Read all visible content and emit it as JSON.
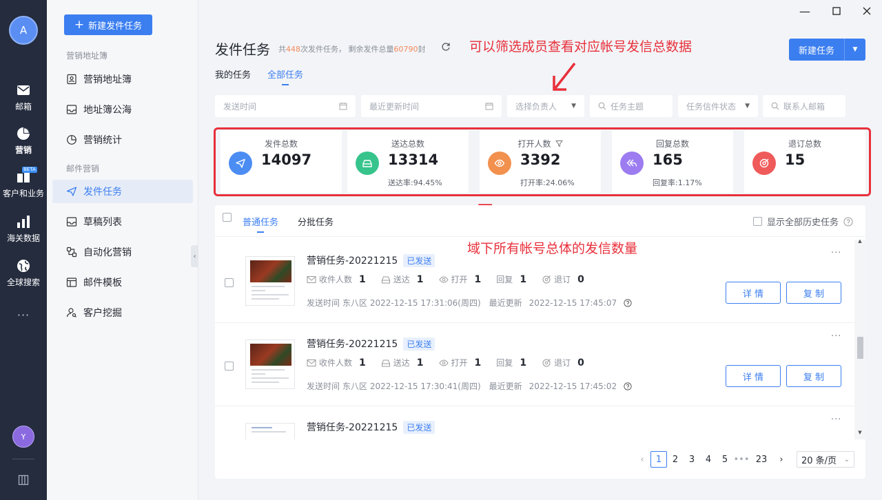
{
  "rail": {
    "user_initial": "A",
    "items": [
      {
        "label": "邮箱",
        "icon": "mail-icon"
      },
      {
        "label": "营销",
        "icon": "pie-chart-icon"
      },
      {
        "label": "客户和业务",
        "icon": "customer-business-icon",
        "badge": "BETA"
      },
      {
        "label": "海关数据",
        "icon": "bar-chart-icon"
      },
      {
        "label": "全球搜索",
        "icon": "globe-icon"
      }
    ],
    "more": "···",
    "bottom_avatar": "Y"
  },
  "sidebar": {
    "new_button": "新建发件任务",
    "section1": "营销地址簿",
    "section2": "邮件营销",
    "items": [
      {
        "label": "营销地址簿",
        "icon": "contact-book-icon"
      },
      {
        "label": "地址簿公海",
        "icon": "inbox-icon"
      },
      {
        "label": "营销统计",
        "icon": "pie-icon"
      },
      {
        "label": "发件任务",
        "icon": "send-icon"
      },
      {
        "label": "草稿列表",
        "icon": "draft-icon"
      },
      {
        "label": "自动化营销",
        "icon": "automation-icon"
      },
      {
        "label": "邮件模板",
        "icon": "template-icon"
      },
      {
        "label": "客户挖掘",
        "icon": "user-search-icon"
      }
    ]
  },
  "header": {
    "title": "发件任务",
    "summary_prefix": "共",
    "task_count": "448",
    "summary_mid": "次发件任务，  剩余发件总量",
    "remaining": "60790",
    "summary_suffix": "封",
    "new_task_button": "新建任务",
    "tabs": [
      "我的任务",
      "全部任务"
    ]
  },
  "annotations": {
    "top": "可以筛选成员查看对应帐号发信总数据",
    "bottom": "域下所有帐号总体的发信数量"
  },
  "filters": {
    "send_time": "发送时间",
    "update_time": "最近更新时间",
    "owner": "选择负责人",
    "subject": "任务主题",
    "status": "任务信件状态",
    "contact_email": "联系人邮箱"
  },
  "stats": [
    {
      "title": "发件总数",
      "value": "14097",
      "sub": "",
      "color": "#4b8df3"
    },
    {
      "title": "送达总数",
      "value": "13314",
      "sub": "送达率:94.45%",
      "color": "#36c48c"
    },
    {
      "title": "打开人数",
      "value": "3392",
      "sub": "打开率:24.06%",
      "color": "#f2904d"
    },
    {
      "title": "回复总数",
      "value": "165",
      "sub": "回复率:1.17%",
      "color": "#9c7cf0"
    },
    {
      "title": "退订总数",
      "value": "15",
      "sub": "",
      "color": "#ef5a5a"
    }
  ],
  "list": {
    "tabs": [
      "普通任务",
      "分批任务"
    ],
    "show_history": "显示全部历史任务",
    "metric_labels": {
      "recipients": "收件人数",
      "delivered": "送达",
      "opened": "打开",
      "replied": "回复",
      "unsubscribed": "退订"
    },
    "send_time_label": "发送时间",
    "update_label": "最近更新",
    "detail_button": "详 情",
    "copy_button": "复 制",
    "rows": [
      {
        "title": "营销任务-20221215",
        "status": "已发送",
        "recipients": "1",
        "delivered": "1",
        "opened": "1",
        "replied": "1",
        "unsubscribed": "0",
        "send_time": "东八区 2022-12-15 17:31:06(周四)",
        "update_time": "2022-12-15 17:45:07"
      },
      {
        "title": "营销任务-20221215",
        "status": "已发送",
        "recipients": "1",
        "delivered": "1",
        "opened": "1",
        "replied": "1",
        "unsubscribed": "0",
        "send_time": "东八区 2022-12-15 17:30:41(周四)",
        "update_time": "2022-12-15 17:45:02"
      },
      {
        "title": "营销任务-20221215",
        "status": "已发送"
      }
    ]
  },
  "pager": {
    "pages": [
      "1",
      "2",
      "3",
      "4",
      "5",
      "•••",
      "23"
    ],
    "current": "1",
    "page_size": "20 条/页"
  }
}
